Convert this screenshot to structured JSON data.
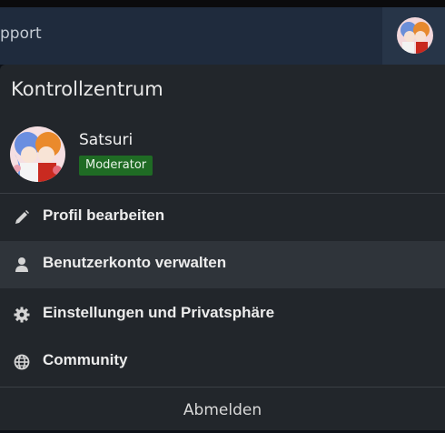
{
  "navbar": {
    "partial_text": "pport",
    "avatar_icon": "user-avatar-icon"
  },
  "panel": {
    "title": "Kontrollzentrum",
    "user": {
      "name": "Satsuri",
      "role": "Moderator"
    },
    "menu": [
      {
        "label": "Profil bearbeiten",
        "icon": "pencil-icon"
      },
      {
        "label": "Benutzerkonto verwalten",
        "icon": "user-icon"
      },
      {
        "label": "Einstellungen und Privatsphäre",
        "icon": "gear-icon"
      },
      {
        "label": "Community",
        "icon": "globe-icon"
      }
    ],
    "logout_label": "Abmelden"
  },
  "colors": {
    "navbar_bg": "#1f2b3d",
    "panel_bg": "#22262b",
    "active_item_bg": "#2f343a",
    "badge_green": "#1f6b24"
  }
}
